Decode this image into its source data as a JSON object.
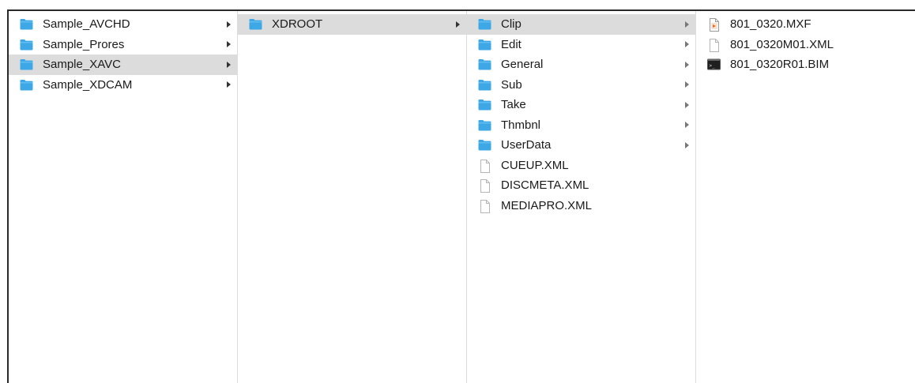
{
  "columns": [
    {
      "id": "col1",
      "items": [
        {
          "label": "Sample_AVCHD",
          "icon": "folder-icon",
          "has_children": true,
          "selected": false
        },
        {
          "label": "Sample_Prores",
          "icon": "folder-icon",
          "has_children": true,
          "selected": false
        },
        {
          "label": "Sample_XAVC",
          "icon": "folder-icon",
          "has_children": true,
          "selected": true
        },
        {
          "label": "Sample_XDCAM",
          "icon": "folder-icon",
          "has_children": true,
          "selected": false
        }
      ]
    },
    {
      "id": "col2",
      "items": [
        {
          "label": "XDROOT",
          "icon": "folder-icon",
          "has_children": true,
          "selected": true
        }
      ]
    },
    {
      "id": "col3",
      "items": [
        {
          "label": "Clip",
          "icon": "folder-icon",
          "has_children": true,
          "selected": true
        },
        {
          "label": "Edit",
          "icon": "folder-icon",
          "has_children": true,
          "selected": false
        },
        {
          "label": "General",
          "icon": "folder-icon",
          "has_children": true,
          "selected": false
        },
        {
          "label": "Sub",
          "icon": "folder-icon",
          "has_children": true,
          "selected": false
        },
        {
          "label": "Take",
          "icon": "folder-icon",
          "has_children": true,
          "selected": false
        },
        {
          "label": "Thmbnl",
          "icon": "folder-icon",
          "has_children": true,
          "selected": false
        },
        {
          "label": "UserData",
          "icon": "folder-icon",
          "has_children": true,
          "selected": false
        },
        {
          "label": "CUEUP.XML",
          "icon": "document-icon",
          "has_children": false,
          "selected": false
        },
        {
          "label": "DISCMETA.XML",
          "icon": "document-icon",
          "has_children": false,
          "selected": false
        },
        {
          "label": "MEDIAPRO.XML",
          "icon": "document-icon",
          "has_children": false,
          "selected": false
        }
      ]
    },
    {
      "id": "col4",
      "items": [
        {
          "label": "801_0320.MXF",
          "icon": "video-file-icon",
          "has_children": false,
          "selected": false
        },
        {
          "label": "801_0320M01.XML",
          "icon": "document-icon",
          "has_children": false,
          "selected": false
        },
        {
          "label": "801_0320R01.BIM",
          "icon": "terminal-file-icon",
          "has_children": false,
          "selected": false
        }
      ]
    }
  ],
  "colors": {
    "folder": "#3ea8e6",
    "folder_tab": "#6cc3f2",
    "selection": "#dcdcdc"
  }
}
